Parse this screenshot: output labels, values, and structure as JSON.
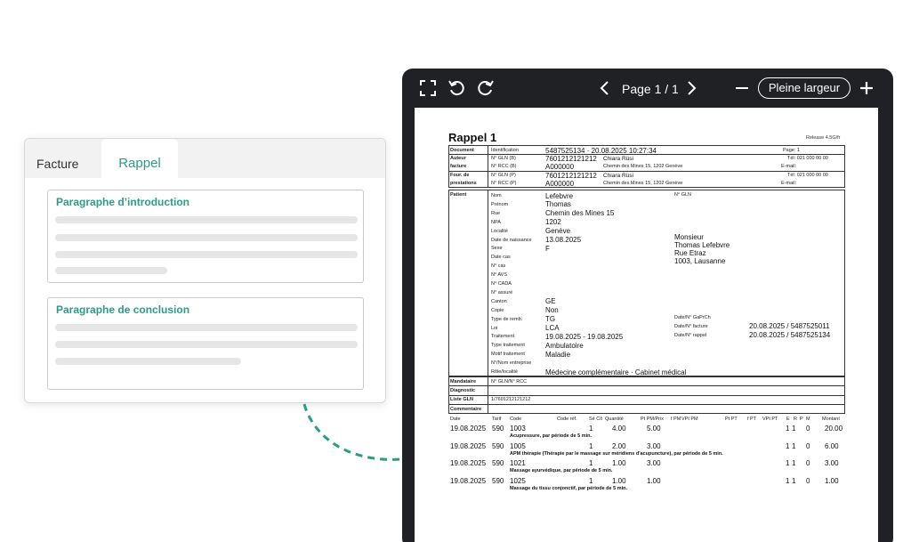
{
  "editor": {
    "tabs": [
      {
        "label": "Facture"
      },
      {
        "label": "Rappel"
      }
    ],
    "sections": [
      {
        "title": "Paragraphe d’introduction"
      },
      {
        "title": "Paragraphe de conclusion"
      }
    ]
  },
  "viewer": {
    "page_indicator": "Page 1 / 1",
    "fit_button": "Pleine largeur",
    "zoom_out": "—",
    "zoom_in": "+"
  },
  "document": {
    "title": "Rappel 1",
    "release": "Release 4.5G/fr",
    "header_labels": [
      "Document",
      "Auteur",
      "facture",
      "Four. de",
      "prestations"
    ],
    "header_rows": [
      {
        "label": "Identification",
        "value": "5487525134 · 20.08.2025 10:27:34",
        "name": "",
        "addr": "",
        "right": "Page: 1"
      },
      {
        "label": "N° GLN (B)",
        "value": "7601212121212",
        "name": "Chiara Rüsi",
        "addr": "",
        "right": "Tél: 021 000 00 00"
      },
      {
        "label": "N° RCC (B)",
        "value": "A000000",
        "name": "Chemin des Mines 15, 1202 Genève",
        "addr": "",
        "right": "E-mail:"
      },
      {
        "label": "N° GLN (P)",
        "value": "7601212121212",
        "name": "Chiara Rüsi",
        "addr": "",
        "right": "Tél: 021 000 00 00"
      },
      {
        "label": "N° RCC (P)",
        "value": "A000000",
        "name": "Chemin des Mines 15, 1202 Genève",
        "addr": "",
        "right": "E-mail:"
      }
    ],
    "patient_label": "Patient",
    "gln_label": "N° GLN",
    "patient_fields": [
      {
        "label": "Nom",
        "value": "Lefebvre"
      },
      {
        "label": "Prénom",
        "value": "Thomas"
      },
      {
        "label": "Rue",
        "value": "Chemin des Mines 15"
      },
      {
        "label": "NPA",
        "value": "1202"
      },
      {
        "label": "Localité",
        "value": "Genève"
      },
      {
        "label": "Date de naissance",
        "value": "13.08.2025"
      },
      {
        "label": "Sexe",
        "value": "F"
      },
      {
        "label": "Date cas",
        "value": ""
      },
      {
        "label": "N° cas",
        "value": ""
      },
      {
        "label": "N° AVS",
        "value": ""
      },
      {
        "label": "N° CADA",
        "value": ""
      },
      {
        "label": "N° assuré",
        "value": ""
      },
      {
        "label": "Canton",
        "value": "GE"
      },
      {
        "label": "Copie",
        "value": "Non"
      },
      {
        "label": "Type de remb.",
        "value": "TG"
      },
      {
        "label": "Loi",
        "value": "LCA"
      },
      {
        "label": "Traitement",
        "value": "19.08.2025 - 19.08.2025"
      },
      {
        "label": "Type traitement",
        "value": "Ambulatoire"
      },
      {
        "label": "Motif traitement",
        "value": "Maladie"
      },
      {
        "label": "N°/Nom entreprise",
        "value": ""
      },
      {
        "label": "Rôle/localité",
        "value": "Médecine complémentaire · Cabinet médical"
      }
    ],
    "address_block": [
      "Monsieur",
      "Thomas Lefebvre",
      "Rue Etraz",
      "1003, Lausanne"
    ],
    "right_fields": [
      {
        "label": "Date/N° GaPrCh",
        "value": ""
      },
      {
        "label": "Date/N° facture",
        "value": "20.08.2025 / 5487525011"
      },
      {
        "label": "Date/N° rappel",
        "value": "20.08.2025 / 5487525134"
      }
    ],
    "bottom_rows": [
      {
        "label": "Mandataire",
        "value": "N° GLN/N° RCC"
      },
      {
        "label": "Diagnostic",
        "value": ""
      },
      {
        "label": "Liste GLN",
        "value": "1/7601212121212"
      },
      {
        "label": "Commentaire",
        "value": ""
      }
    ],
    "columns": [
      "Date",
      "Tarif",
      "Code",
      "Code réf.",
      "Sé Cô",
      "Quantité",
      "Pt PM/Prix",
      "f PM",
      "VPt PM",
      "Pt PT",
      "f PT",
      "VPt PT",
      "E",
      "R",
      "P",
      "M",
      "Montant"
    ],
    "services": [
      {
        "date": "19.08.2025",
        "tarif": "590",
        "code": "1003",
        "se": "1",
        "qty": "4.00",
        "price": "5.00",
        "e": "1",
        "r": "1",
        "p": "0",
        "amount": "20.00",
        "desc": "Acupressure, par période de 5 min."
      },
      {
        "date": "19.08.2025",
        "tarif": "590",
        "code": "1005",
        "se": "1",
        "qty": "2.00",
        "price": "3.00",
        "e": "1",
        "r": "1",
        "p": "0",
        "amount": "6.00",
        "desc": "APM thérapie (Thérapie par le massage sur méridiens d'acupuncture), par période de 5 min."
      },
      {
        "date": "19.08.2025",
        "tarif": "590",
        "code": "1021",
        "se": "1",
        "qty": "1.00",
        "price": "3.00",
        "e": "1",
        "r": "1",
        "p": "0",
        "amount": "3.00",
        "desc": "Massage ayurvédique, par période de 5 min."
      },
      {
        "date": "19.08.2025",
        "tarif": "590",
        "code": "1025",
        "se": "1",
        "qty": "1.00",
        "price": "1.00",
        "e": "1",
        "r": "1",
        "p": "0",
        "amount": "1.00",
        "desc": "Massage du tissu conjonctif, par période de 5 min."
      }
    ]
  }
}
